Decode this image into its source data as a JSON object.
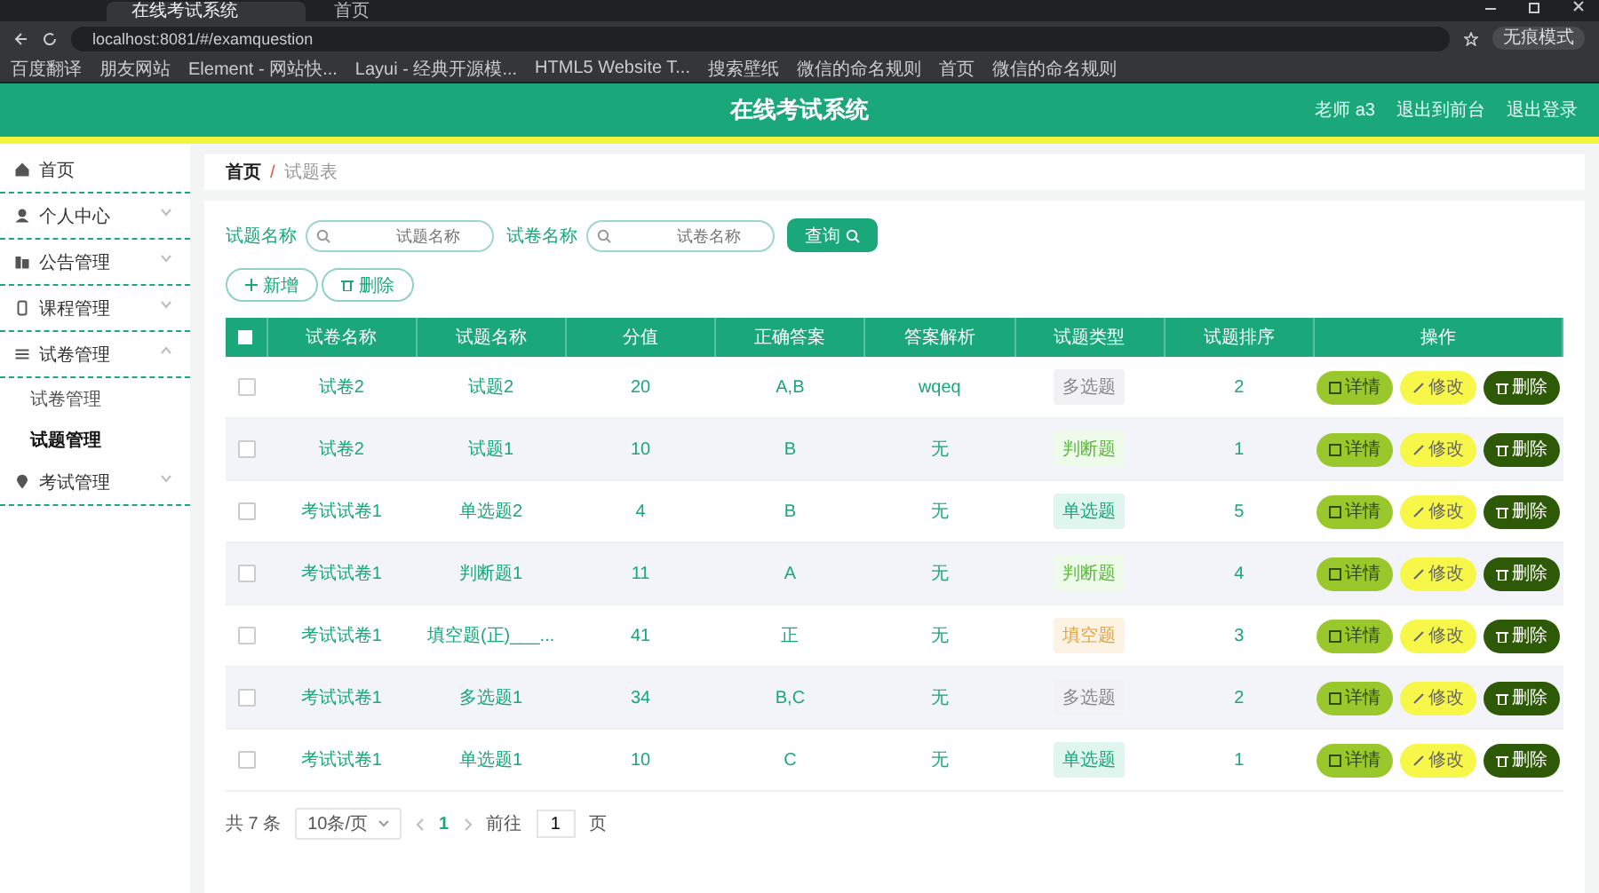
{
  "browser": {
    "tabs": [
      {
        "title": "在线考试系统",
        "selected": true
      },
      {
        "title": "首页",
        "selected": false
      }
    ],
    "address": "localhost:8081/#/examquestion",
    "profile": "无痕模式",
    "bookmarks": [
      "百度翻译",
      "朋友网站",
      "Element - 网站快...",
      "Layui - 经典开源模...",
      "HTML5 Website T...",
      "搜索壁纸",
      "微信的命名规则",
      "首页",
      "微信的命名规则"
    ]
  },
  "header": {
    "title": "在线考试系统",
    "links": [
      "老师 a3",
      "退出到前台",
      "退出登录"
    ]
  },
  "sidebar": {
    "items": [
      {
        "label": "首页"
      },
      {
        "label": "个人中心",
        "expanded": false
      },
      {
        "label": "公告管理",
        "expanded": false
      },
      {
        "label": "课程管理",
        "expanded": false
      },
      {
        "label": "试卷管理",
        "expanded": true,
        "children": [
          {
            "label": "试卷管理",
            "selected": false
          },
          {
            "label": "试题管理",
            "selected": true
          }
        ]
      },
      {
        "label": "考试管理",
        "expanded": false
      }
    ]
  },
  "breadcrumb": [
    "首页",
    "/",
    "试题表"
  ],
  "search": [
    {
      "label": "试题名称",
      "placeholder": "试题名称"
    },
    {
      "label": "试卷名称",
      "placeholder": "试卷名称"
    }
  ],
  "query_button": "查询",
  "toolbar": [
    "新增",
    "删除"
  ],
  "table": {
    "columns": [
      "试卷名称",
      "试题名称",
      "分值",
      "正确答案",
      "答案解析",
      "试题类型",
      "试题排序",
      "操作"
    ],
    "select_all_checked": false,
    "rows": [
      {
        "paper": "试卷2",
        "question": "试题2",
        "score": "20",
        "answer": "A,B",
        "analysis": "wqeq",
        "type": "多选题",
        "kind": "multi",
        "order": "2",
        "checked": false,
        "actions": [
          "详情",
          "修改",
          "删除"
        ]
      },
      {
        "paper": "试卷2",
        "question": "试题1",
        "score": "10",
        "answer": "B",
        "analysis": "无",
        "type": "判断题",
        "kind": "judge",
        "order": "1",
        "checked": false,
        "actions": [
          "详情",
          "修改",
          "删除"
        ]
      },
      {
        "paper": "考试试卷1",
        "question": "单选题2",
        "score": "4",
        "answer": "B",
        "analysis": "无",
        "type": "单选题",
        "kind": "single",
        "order": "5",
        "checked": false,
        "actions": [
          "详情",
          "修改",
          "删除"
        ]
      },
      {
        "paper": "考试试卷1",
        "question": "判断题1",
        "score": "11",
        "answer": "A",
        "analysis": "无",
        "type": "判断题",
        "kind": "judge",
        "order": "4",
        "checked": false,
        "actions": [
          "详情",
          "修改",
          "删除"
        ]
      },
      {
        "paper": "考试试卷1",
        "question": "填空题(正)___...",
        "score": "41",
        "answer": "正",
        "analysis": "无",
        "type": "填空题",
        "kind": "fill",
        "order": "3",
        "checked": false,
        "actions": [
          "详情",
          "修改",
          "删除"
        ]
      },
      {
        "paper": "考试试卷1",
        "question": "多选题1",
        "score": "34",
        "answer": "B,C",
        "analysis": "无",
        "type": "多选题",
        "kind": "multi",
        "order": "2",
        "checked": false,
        "actions": [
          "详情",
          "修改",
          "删除"
        ]
      },
      {
        "paper": "考试试卷1",
        "question": "单选题1",
        "score": "10",
        "answer": "C",
        "analysis": "无",
        "type": "单选题",
        "kind": "single",
        "order": "1",
        "checked": false,
        "actions": [
          "详情",
          "修改",
          "删除"
        ]
      }
    ]
  },
  "pagination": {
    "total": "共 7 条",
    "page_size": "10条/页",
    "pages": [
      {
        "label": "1",
        "selected": true
      }
    ],
    "goto_label": "前往",
    "goto_value": "1",
    "goto_suffix": "页"
  }
}
